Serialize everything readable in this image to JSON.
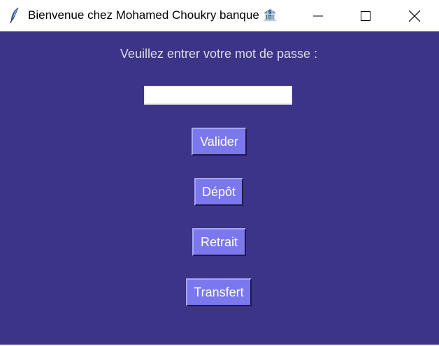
{
  "window": {
    "title": "Bienvenue chez Mohamed Choukry banque 🏦",
    "icon": "feather-icon"
  },
  "form": {
    "prompt": "Veuillez entrer votre mot de passe :",
    "password_value": ""
  },
  "buttons": {
    "validate_label": "Valider",
    "deposit_label": "Dépôt",
    "withdraw_label": "Retrait",
    "transfer_label": "Transfert"
  },
  "colors": {
    "background": "#3b3487",
    "button": "#7b78ee",
    "button_text": "#ffffff",
    "prompt_text": "#dcdcf0"
  }
}
